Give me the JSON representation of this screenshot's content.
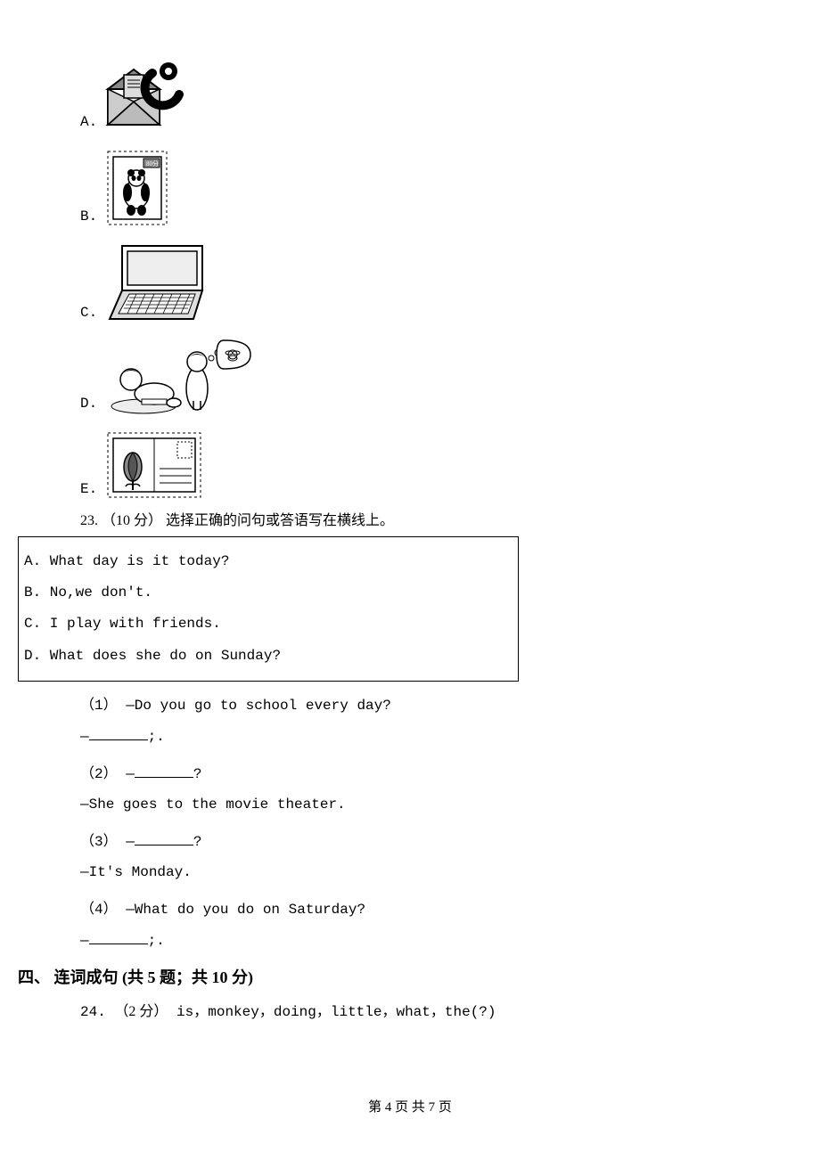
{
  "optionA": {
    "label": "A."
  },
  "optionB": {
    "label": "B."
  },
  "optionC": {
    "label": "C."
  },
  "optionD": {
    "label": "D."
  },
  "optionE": {
    "label": "E."
  },
  "q23": {
    "num": "23.",
    "points": "（10 分）",
    "instruction": " 选择正确的问句或答语写在横线上。",
    "choices": {
      "a": "A. What day is it today?",
      "b": "B. No,we don't.",
      "c": "C. I play with friends.",
      "d": "D. What does she do on Sunday?"
    },
    "sub1_q": "（1） —Do you go to school every day?",
    "sub1_a_prefix": "—",
    "sub1_a_suffix": ";.",
    "sub2_q_prefix": "（2） —",
    "sub2_q_suffix": "?",
    "sub2_a": "—She goes to the movie theater.",
    "sub3_q_prefix": "（3） —",
    "sub3_q_suffix": "?",
    "sub3_a": "—It's Monday.",
    "sub4_q": "（4） —What do you do on Saturday?",
    "sub4_a_prefix": "—",
    "sub4_a_suffix": ";."
  },
  "section4": {
    "heading": "四、 连词成句 (共 5 题；共 10 分)"
  },
  "q24": {
    "num": "24.",
    "points": "（2 分）",
    "text": " is，monkey，doing，little，what，the(?)"
  },
  "footer": "第 4 页 共 7 页"
}
